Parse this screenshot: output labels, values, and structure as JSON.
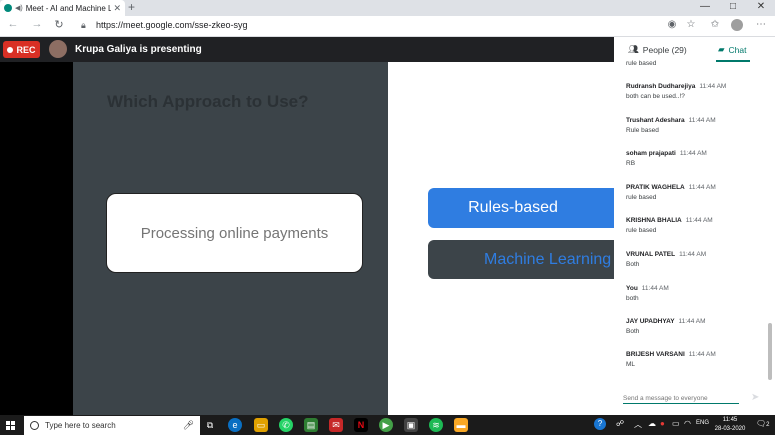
{
  "browser": {
    "tab_title": "Meet - AI and Machine Lea",
    "new_tab": "+",
    "url": "https://meet.google.com/sse-zkeo-syg",
    "window_controls": [
      "—",
      "□",
      "✕"
    ]
  },
  "meet": {
    "rec_label": "REC",
    "presenting_label": "Krupa Galiya is presenting"
  },
  "slide": {
    "title": "Which Approach to Use?",
    "example": "Processing online payments",
    "option_rules": "Rules-based",
    "option_ml": "Machine Learning"
  },
  "panel": {
    "people_tab": "People (29)",
    "chat_tab": "Chat",
    "composer_placeholder": "Send a message to everyone"
  },
  "chat": {
    "partial_top": "rule based",
    "messages": [
      {
        "sender": "Rudransh Dudharejiya",
        "time": "11:44 AM",
        "text": "both can be used..!?"
      },
      {
        "sender": "Trushant Adeshara",
        "time": "11:44 AM",
        "text": "Rule based"
      },
      {
        "sender": "soham prajapati",
        "time": "11:44 AM",
        "text": "RB"
      },
      {
        "sender": "PRATIK WAGHELA",
        "time": "11:44 AM",
        "text": "rule based"
      },
      {
        "sender": "KRISHNA BHALIA",
        "time": "11:44 AM",
        "text": "rule based"
      },
      {
        "sender": "VRUNAL PATEL",
        "time": "11:44 AM",
        "text": "Both"
      },
      {
        "sender": "You",
        "time": "11:44 AM",
        "text": "both"
      },
      {
        "sender": "JAY UPADHYAY",
        "time": "11:44 AM",
        "text": "Both"
      },
      {
        "sender": "BRIJESH VARSANI",
        "time": "11:44 AM",
        "text": "ML"
      }
    ]
  },
  "taskbar": {
    "search_placeholder": "Type here to search",
    "lang": "ENG",
    "time": "11:45",
    "date": "28-03-2020",
    "notification_count": "2"
  },
  "colors": {
    "rec": "#d93025",
    "accent": "#00796b",
    "slide_blue": "#2f7de1",
    "slide_dark": "#3c4449"
  }
}
